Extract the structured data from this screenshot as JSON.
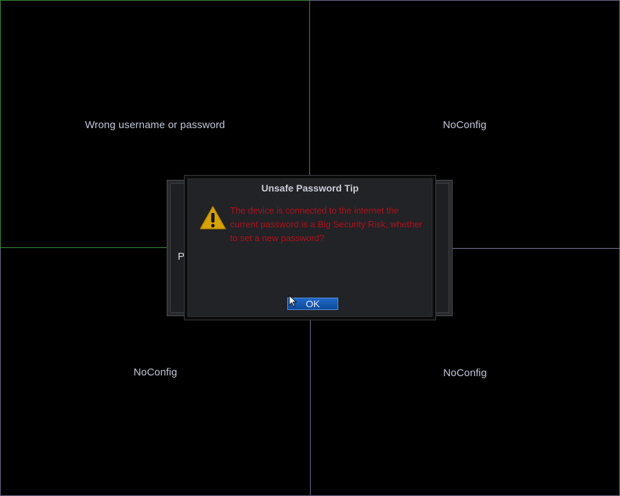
{
  "channels": [
    {
      "id": "ch1",
      "status": "Wrong username or password"
    },
    {
      "id": "ch2",
      "status": "NoConfig"
    },
    {
      "id": "ch3",
      "status": "NoConfig"
    },
    {
      "id": "ch4",
      "status": "NoConfig"
    }
  ],
  "background_dialog": {
    "partial_text": "P"
  },
  "dialog": {
    "title": "Unsafe Password Tip",
    "icon": "warning-icon",
    "message": "The device is connected to the internet the current password is a Big Security Risk, whether to set a new password?",
    "ok_label": "OK"
  },
  "colors": {
    "grid_active": "#3d8a3d",
    "grid_line": "#6a6a8c",
    "message": "#b0101a",
    "button": "#1a5fb8",
    "warning": "#d9a400"
  }
}
